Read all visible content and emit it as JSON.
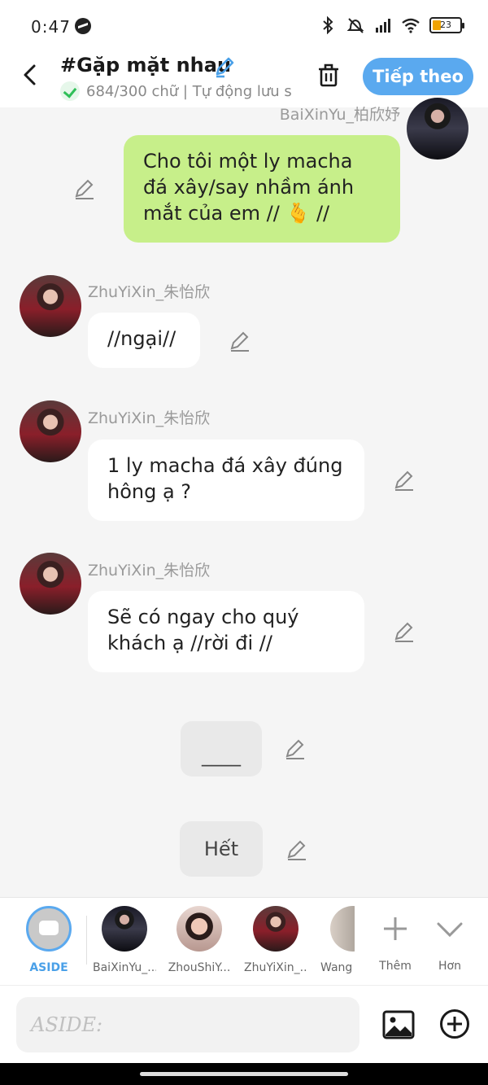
{
  "status": {
    "time": "0:47",
    "battery": "23"
  },
  "header": {
    "title": "#Gặp mặt nhau",
    "subtitle": "684/300 chữ | Tự động lưu s",
    "next_label": "Tiếp theo"
  },
  "messages": [
    {
      "sender": "BaiXinYu_柏欣妤",
      "text": "Cho tôi một ly macha đá xây/say nhầm ánh mắt của em // 🫰 //"
    },
    {
      "sender": "ZhuYiXin_朱怡欣",
      "text": "//ngại//"
    },
    {
      "sender": "ZhuYiXin_朱怡欣",
      "text": "1 ly macha đá xây đúng hông ạ ?"
    },
    {
      "sender": "ZhuYiXin_朱怡欣",
      "text": "Sẽ có ngay cho quý khách ạ //rời đi //"
    }
  ],
  "asides": [
    {
      "text": "____"
    },
    {
      "text": "Hết"
    }
  ],
  "characters": [
    {
      "label": "ASIDE"
    },
    {
      "label": "BaiXinYu_..."
    },
    {
      "label": "ZhouShiY..."
    },
    {
      "label": "ZhuYiXin_..."
    },
    {
      "label": "Wang"
    }
  ],
  "actions": {
    "add_label": "Thêm",
    "more_label": "Hơn"
  },
  "input": {
    "placeholder": "ASIDE:"
  },
  "icons": {
    "back": "back-arrow-icon",
    "edit": "pencil-icon",
    "trash": "trash-icon",
    "image": "image-icon",
    "add": "plus-circle-icon"
  },
  "colors": {
    "accent": "#5aa9ef",
    "my_bubble": "#c7ef8a",
    "check": "#2fbf58"
  }
}
